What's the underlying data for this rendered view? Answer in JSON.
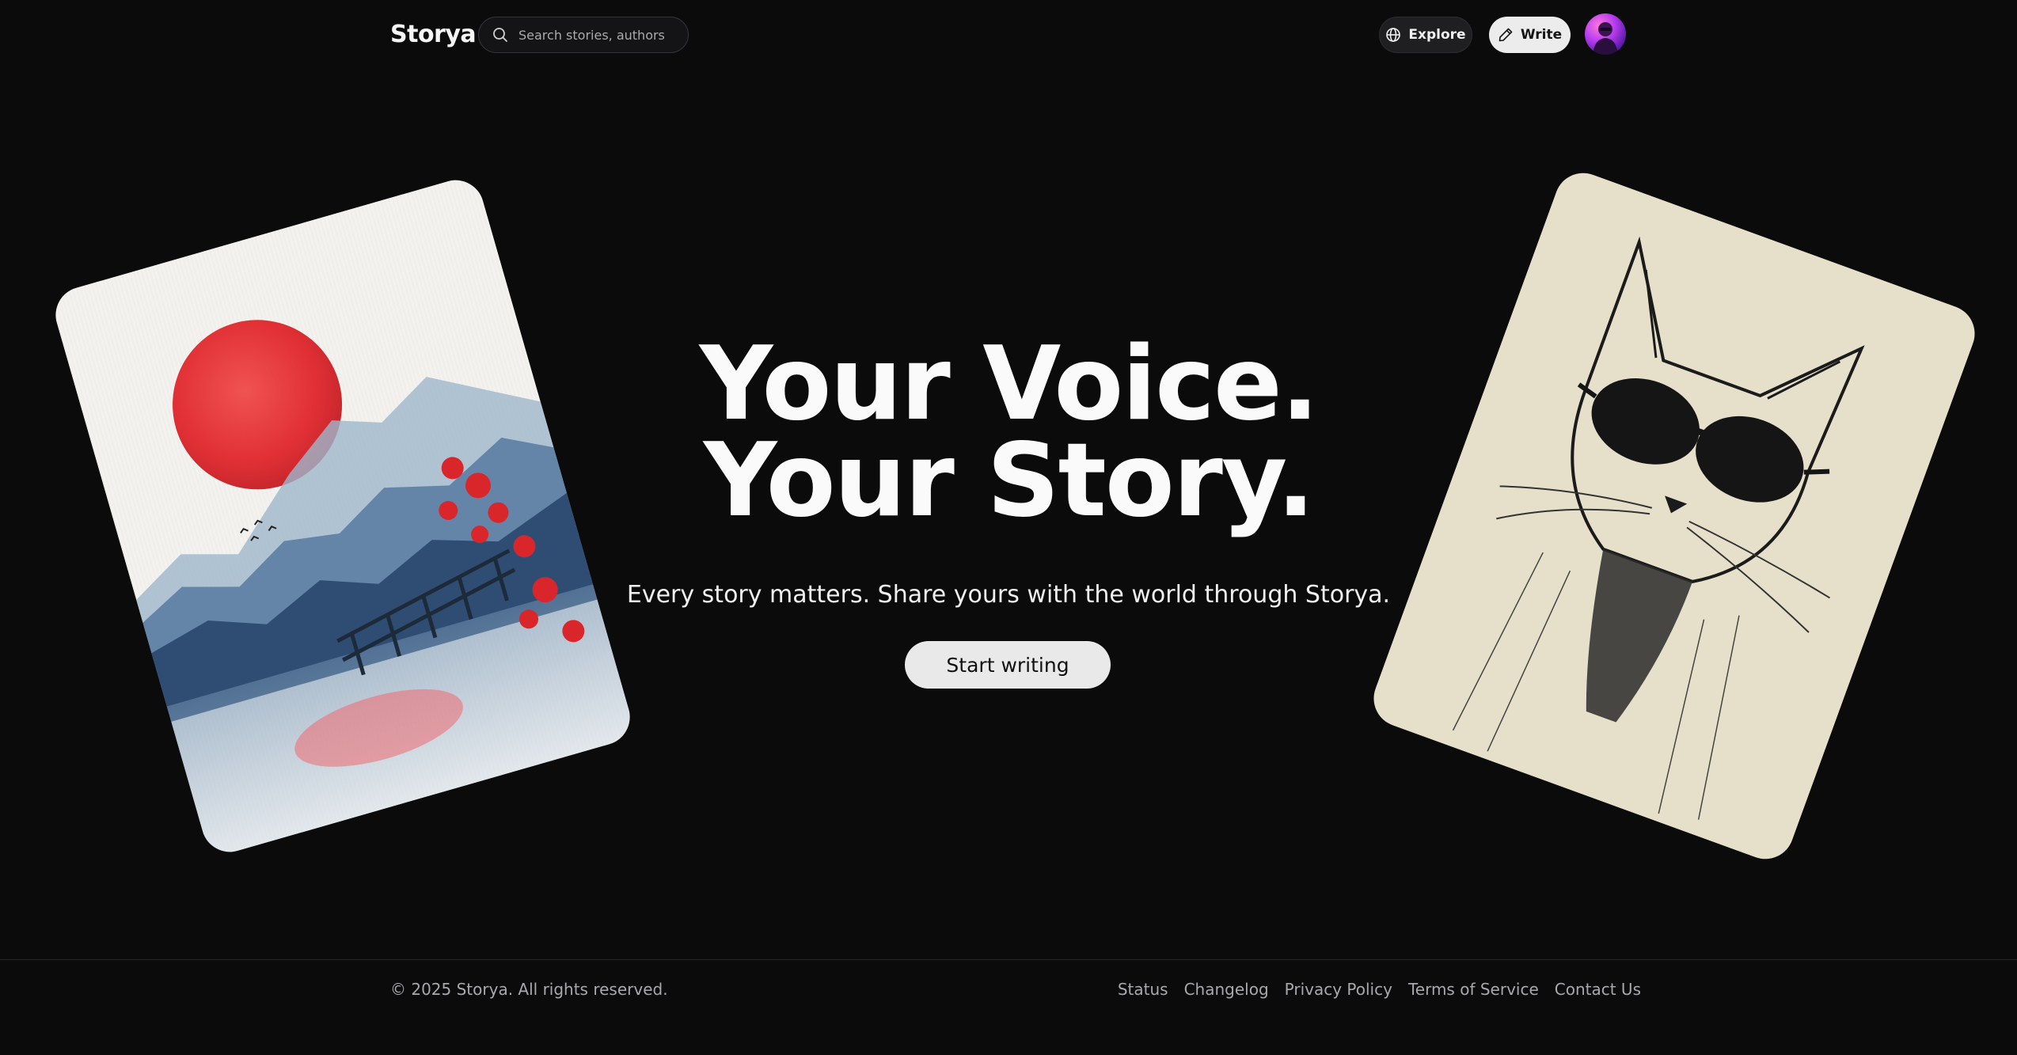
{
  "header": {
    "logo": "Storya",
    "search": {
      "placeholder": "Search stories, authors,"
    },
    "explore_label": "Explore",
    "write_label": "Write"
  },
  "hero": {
    "title_line1": "Your Voice.",
    "title_line2": "Your Story.",
    "subtitle": "Every story matters. Share yours with the world through Storya.",
    "cta_label": "Start writing"
  },
  "footer": {
    "copyright": "© 2025 Storya. All rights reserved.",
    "links": [
      "Status",
      "Changelog",
      "Privacy Policy",
      "Terms of Service",
      "Contact Us"
    ]
  },
  "colors": {
    "background": "#0b0b0c",
    "accent_red": "#e8262b",
    "cta_background": "#e9e9e9"
  }
}
